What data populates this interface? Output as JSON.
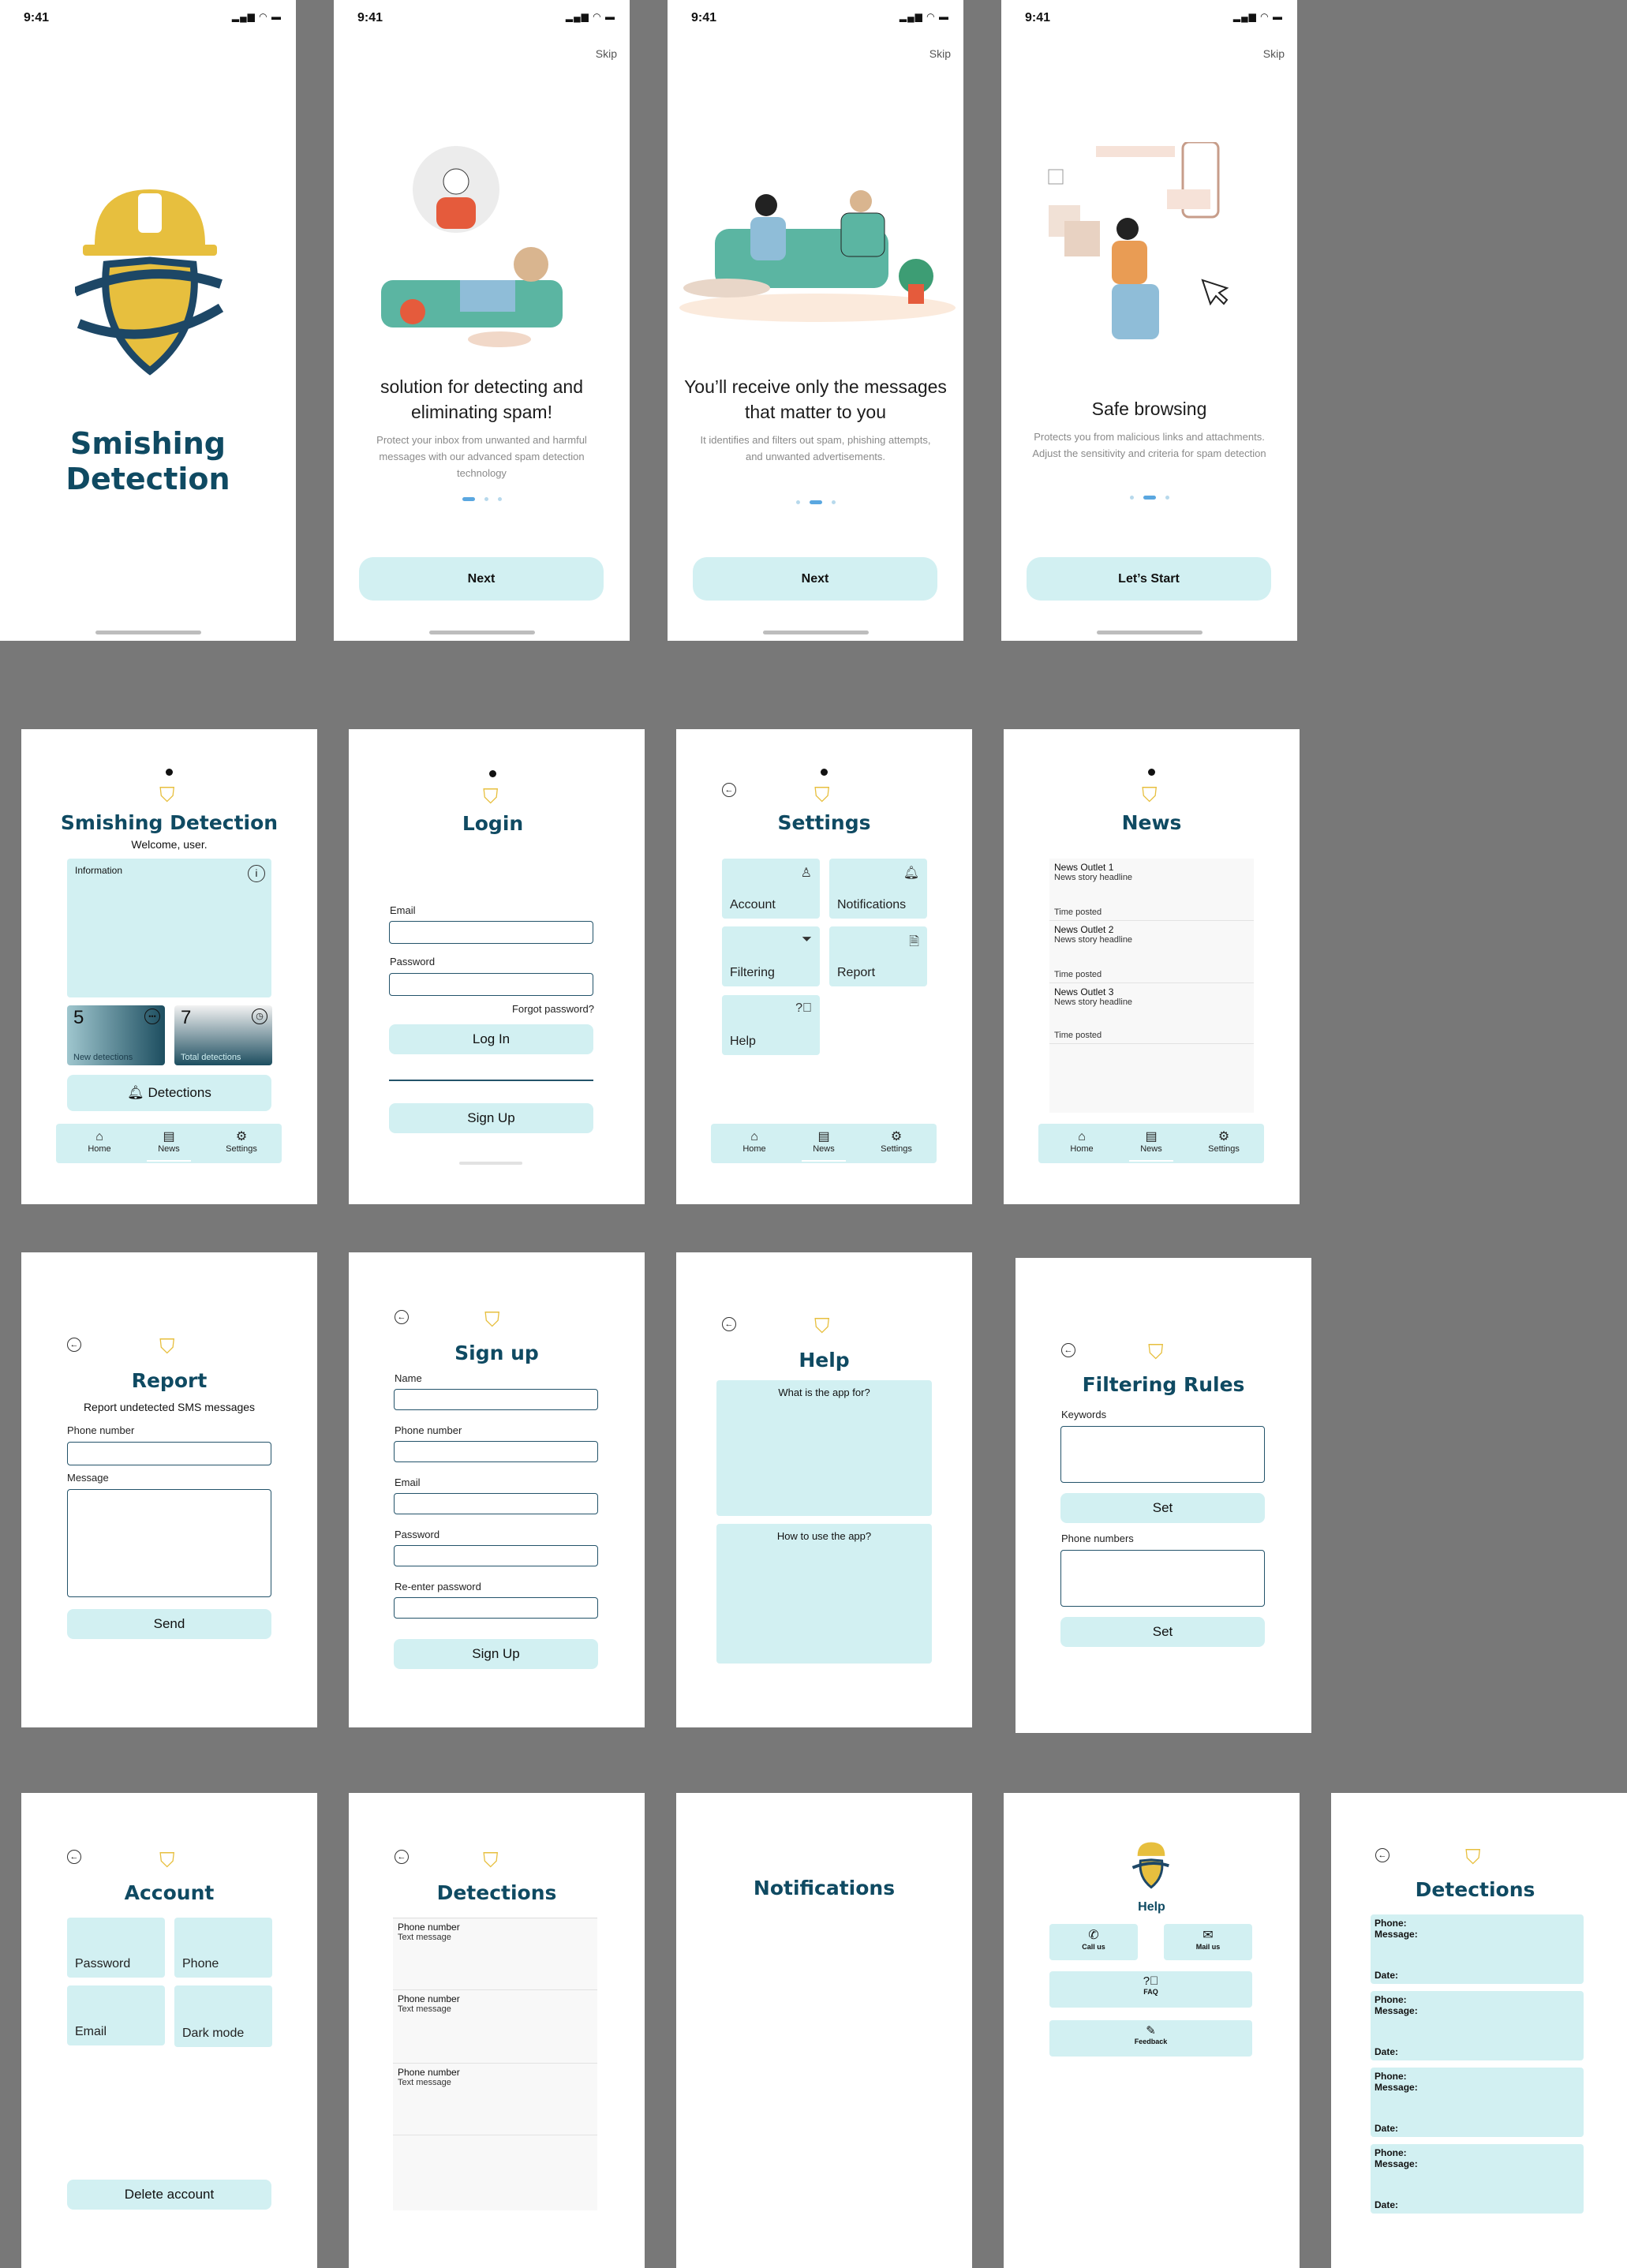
{
  "status_time": "9:41",
  "skip": "Skip",
  "splash": {
    "title_line1": "Smishing",
    "title_line2": "Detection"
  },
  "onboarding": [
    {
      "title": "solution for detecting and eliminating spam!",
      "body": "Protect your inbox from unwanted and harmful messages with our advanced spam detection technology",
      "button": "Next"
    },
    {
      "title": "You’ll receive only the messages that matter to you",
      "body": "It identifies and filters out spam, phishing attempts, and unwanted advertisements.",
      "button": "Next"
    },
    {
      "title": "Safe browsing",
      "body": "Protects you from malicious links and attachments. Adjust the sensitivity and criteria for spam detection",
      "button": "Let’s Start"
    }
  ],
  "home": {
    "title": "Smishing Detection",
    "welcome": "Welcome, user.",
    "info": "Information",
    "new_count": "5",
    "new_label": "New detections",
    "total_count": "7",
    "total_label": "Total detections",
    "detections_button": "Detections"
  },
  "nav": {
    "home": "Home",
    "news": "News",
    "settings": "Settings"
  },
  "login": {
    "title": "Login",
    "email": "Email",
    "password": "Password",
    "forgot": "Forgot password?",
    "login_button": "Log In",
    "signup_button": "Sign Up"
  },
  "settings": {
    "title": "Settings",
    "account": "Account",
    "notifications": "Notifications",
    "filtering": "Filtering",
    "report": "Report",
    "help": "Help"
  },
  "news": {
    "title": "News",
    "items": [
      {
        "outlet": "News Outlet 1",
        "headline": "News story headline",
        "time": "Time posted"
      },
      {
        "outlet": "News Outlet 2",
        "headline": "News story headline",
        "time": "Time posted"
      },
      {
        "outlet": "News Outlet 3",
        "headline": "News story headline",
        "time": "Time posted"
      }
    ]
  },
  "report": {
    "title": "Report",
    "subtitle": "Report undetected SMS messages",
    "phone": "Phone number",
    "message": "Message",
    "send": "Send"
  },
  "signup": {
    "title": "Sign up",
    "name": "Name",
    "phone": "Phone number",
    "email": "Email",
    "password": "Password",
    "reenter": "Re-enter password",
    "button": "Sign Up"
  },
  "help": {
    "title": "Help",
    "q1": "What is the app for?",
    "q2": "How to use the app?"
  },
  "filtering": {
    "title": "Filtering Rules",
    "keywords": "Keywords",
    "set": "Set",
    "phones": "Phone numbers"
  },
  "account": {
    "title": "Account",
    "password": "Password",
    "phone": "Phone",
    "email": "Email",
    "dark": "Dark mode",
    "delete": "Delete account"
  },
  "detections": {
    "title": "Detections",
    "items": [
      {
        "phone": "Phone number",
        "text": "Text message"
      },
      {
        "phone": "Phone number",
        "text": "Text message"
      },
      {
        "phone": "Phone number",
        "text": "Text message"
      }
    ]
  },
  "notifications": {
    "title": "Notifications"
  },
  "help2": {
    "title": "Help",
    "call": "Call us",
    "mail": "Mail us",
    "faq": "FAQ",
    "feedback": "Feedback"
  },
  "detections2": {
    "title": "Detections",
    "phone": "Phone:",
    "message": "Message:",
    "date": "Date:"
  }
}
